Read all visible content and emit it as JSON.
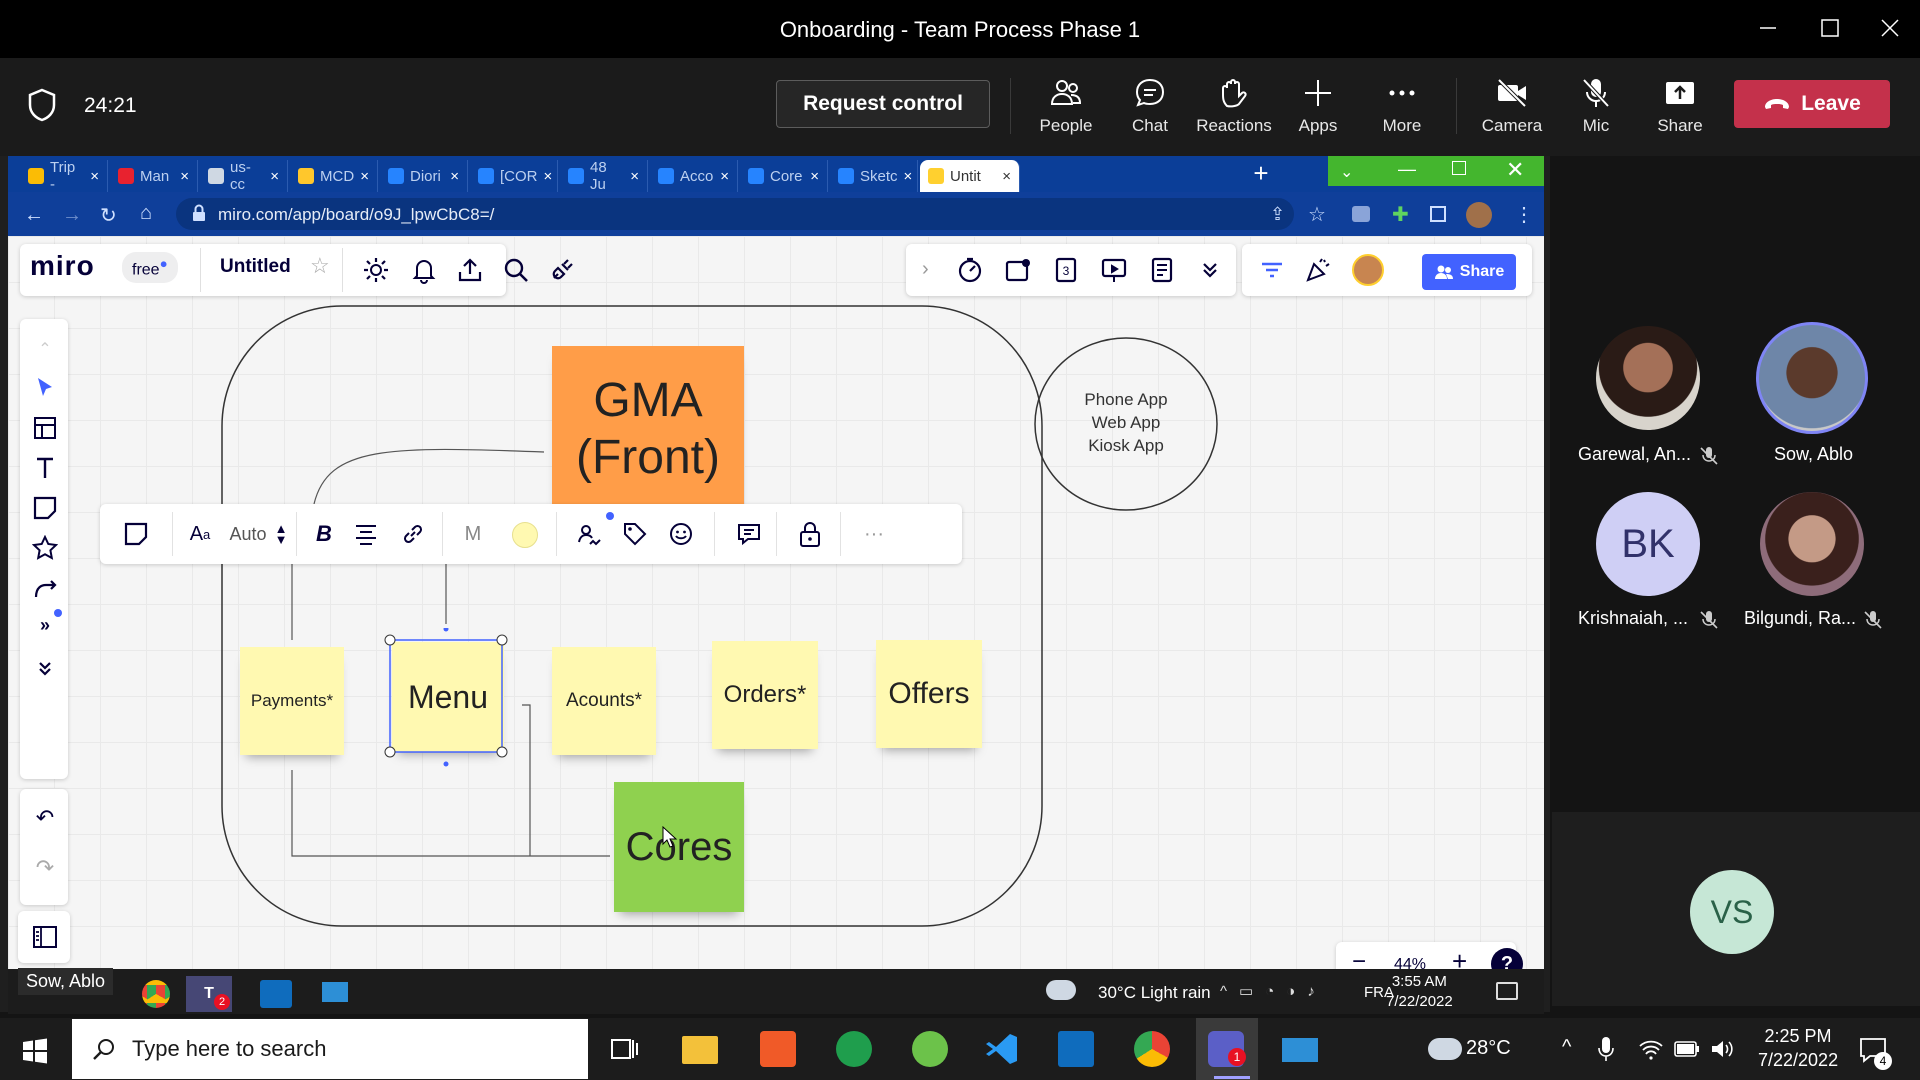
{
  "window": {
    "title": "Onboarding - Team Process Phase 1"
  },
  "meeting": {
    "timer": "24:21",
    "request_control": "Request control",
    "controls": [
      {
        "label": "People"
      },
      {
        "label": "Chat"
      },
      {
        "label": "Reactions"
      },
      {
        "label": "Apps"
      },
      {
        "label": "More"
      },
      {
        "label": "Camera"
      },
      {
        "label": "Mic"
      },
      {
        "label": "Share"
      }
    ],
    "leave": "Leave",
    "leave_color": "#c4314b"
  },
  "browser": {
    "tabs": [
      {
        "label": "Trip -",
        "icon": "google-drive-icon"
      },
      {
        "label": "Man",
        "icon": "adobe-icon"
      },
      {
        "label": "us-cc",
        "icon": "globe-icon"
      },
      {
        "label": "MCD",
        "icon": "mcdonalds-icon"
      },
      {
        "label": "Diori",
        "icon": "jira-icon"
      },
      {
        "label": "[COR",
        "icon": "jira-icon"
      },
      {
        "label": "48 Ju",
        "icon": "confluence-icon"
      },
      {
        "label": "Acco",
        "icon": "confluence-icon"
      },
      {
        "label": "Core",
        "icon": "confluence-icon"
      },
      {
        "label": "Sketc",
        "icon": "sketch-icon"
      },
      {
        "label": "Untit",
        "icon": "miro-icon"
      }
    ],
    "url": "miro.com/app/board/o9J_lpwCbC8=/"
  },
  "miro": {
    "logo": "miro",
    "plan": "free",
    "board_title": "Untitled",
    "share_label": "Share",
    "share_color": "#4262ff",
    "zoom": "44%",
    "help": "?",
    "context_toolbar": {
      "font_size": "Auto",
      "font": "M"
    },
    "stickies": {
      "gma": "GMA\n(Front)",
      "payments": "Payments*",
      "menu": "Menu",
      "acounts": "Acounts*",
      "orders": "Orders*",
      "offers": "Offers",
      "cores": "Cores"
    },
    "circle_text": [
      "Phone App",
      "Web App",
      "Kiosk App"
    ],
    "colors": {
      "orange": "#ff9d48",
      "yellow": "#fff9b1",
      "green": "#8fd14f"
    }
  },
  "participants": [
    {
      "name": "Garewal, An...",
      "muted": true
    },
    {
      "name": "Sow, Ablo",
      "muted": false,
      "speaking": true
    },
    {
      "name": "Krishnaiah, ...",
      "initials": "BK",
      "muted": true
    },
    {
      "name": "Bilgundi, Ra...",
      "muted": true
    },
    {
      "name": "",
      "initials": "VS"
    }
  ],
  "remote_desktop": {
    "owner_label": "Sow, Ablo",
    "weather": "30°C  Light rain",
    "lang": "FRA",
    "time": "3:55 AM",
    "date": "7/22/2022",
    "teams_badge": "2"
  },
  "taskbar": {
    "search_placeholder": "Type here to search",
    "weather": "28°C",
    "time": "2:25 PM",
    "date": "7/22/2022",
    "notifications": "4",
    "teams_badge": "1"
  }
}
